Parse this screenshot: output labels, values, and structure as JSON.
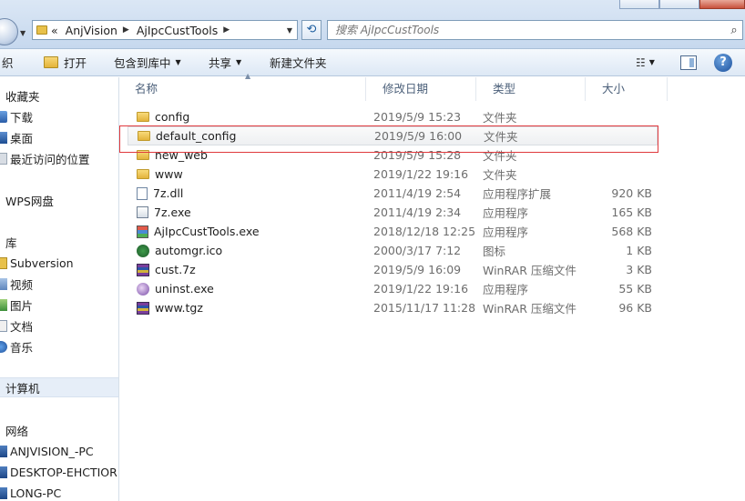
{
  "address": {
    "overflow": "«",
    "crumbs": [
      "AnjVision",
      "AjIpcCustTools"
    ]
  },
  "search": {
    "placeholder": "搜索 AjIpcCustTools"
  },
  "toolbar": {
    "organize_label": "织",
    "open_label": "打开",
    "library_label": "包含到库中",
    "share_label": "共享",
    "newfolder_label": "新建文件夹"
  },
  "nav": {
    "favorites": "收藏夹",
    "downloads": "下载",
    "desktop": "桌面",
    "recent": "最近访问的位置",
    "wps": "WPS网盘",
    "libraries": "库",
    "subversion": "Subversion",
    "videos": "视频",
    "pictures": "图片",
    "documents": "文档",
    "music": "音乐",
    "computer": "计算机",
    "network": "网络",
    "pc1": "ANJVISION_-PC",
    "pc2": "DESKTOP-EHCTIOR",
    "pc3": "LONG-PC"
  },
  "columns": {
    "name": "名称",
    "date": "修改日期",
    "type": "类型",
    "size": "大小"
  },
  "files": [
    {
      "name": "config",
      "date": "2019/5/9 15:23",
      "type": "文件夹",
      "size": "",
      "icon": "folder"
    },
    {
      "name": "default_config",
      "date": "2019/5/9 16:00",
      "type": "文件夹",
      "size": "",
      "icon": "folder"
    },
    {
      "name": "new_web",
      "date": "2019/5/9 15:28",
      "type": "文件夹",
      "size": "",
      "icon": "folder"
    },
    {
      "name": "www",
      "date": "2019/1/22 19:16",
      "type": "文件夹",
      "size": "",
      "icon": "folder"
    },
    {
      "name": "7z.dll",
      "date": "2011/4/19 2:54",
      "type": "应用程序扩展",
      "size": "920 KB",
      "icon": "dll"
    },
    {
      "name": "7z.exe",
      "date": "2011/4/19 2:34",
      "type": "应用程序",
      "size": "165 KB",
      "icon": "exe"
    },
    {
      "name": "AjIpcCustTools.exe",
      "date": "2018/12/18 12:25",
      "type": "应用程序",
      "size": "568 KB",
      "icon": "app"
    },
    {
      "name": "automgr.ico",
      "date": "2000/3/17 7:12",
      "type": "图标",
      "size": "1 KB",
      "icon": "ico"
    },
    {
      "name": "cust.7z",
      "date": "2019/5/9 16:09",
      "type": "WinRAR 压缩文件",
      "size": "3 KB",
      "icon": "rar"
    },
    {
      "name": "uninst.exe",
      "date": "2019/1/22 19:16",
      "type": "应用程序",
      "size": "55 KB",
      "icon": "uninst"
    },
    {
      "name": "www.tgz",
      "date": "2015/11/17 11:28",
      "type": "WinRAR 压缩文件",
      "size": "96 KB",
      "icon": "rar"
    }
  ]
}
